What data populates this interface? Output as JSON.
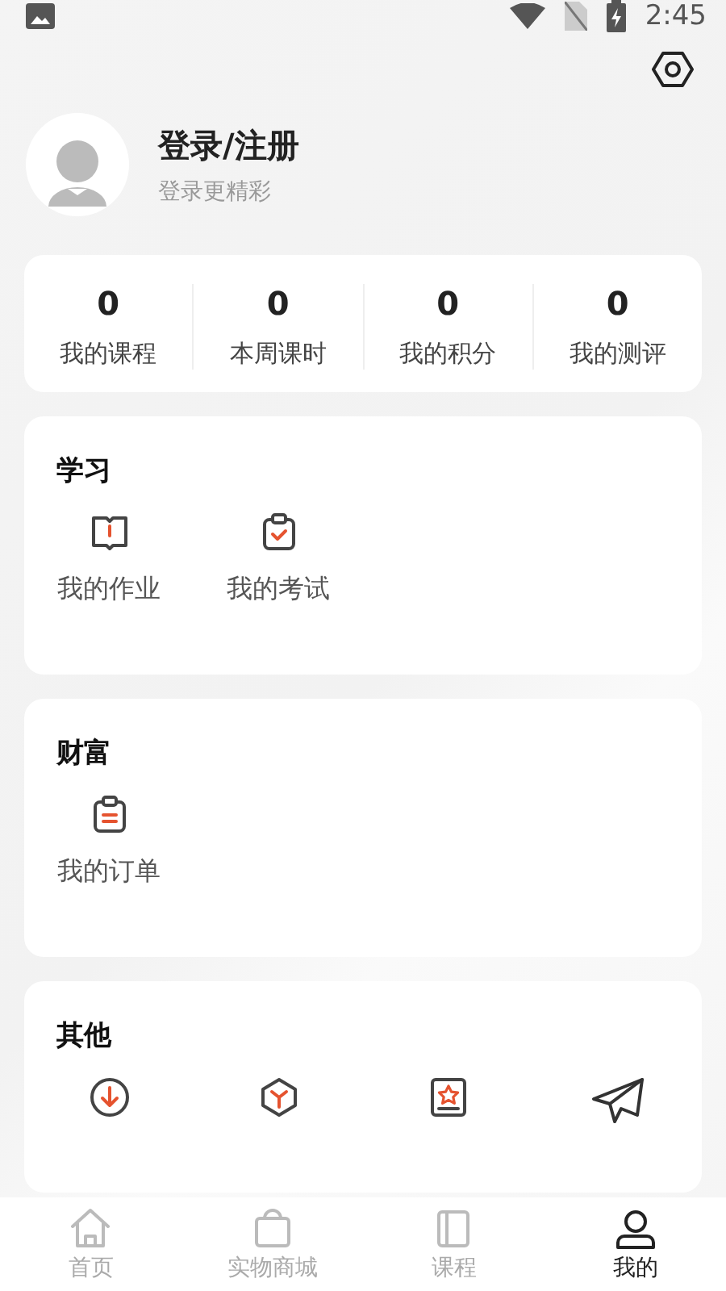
{
  "status_bar": {
    "time": "2:45"
  },
  "profile": {
    "title": "登录/注册",
    "subtitle": "登录更精彩"
  },
  "stats": [
    {
      "value": "0",
      "label": "我的课程"
    },
    {
      "value": "0",
      "label": "本周课时"
    },
    {
      "value": "0",
      "label": "我的积分"
    },
    {
      "value": "0",
      "label": "我的测评"
    }
  ],
  "sections": [
    {
      "title": "学习",
      "items": [
        {
          "kind": "book",
          "label": "我的作业"
        },
        {
          "kind": "exam",
          "label": "我的考试"
        }
      ]
    },
    {
      "title": "财富",
      "items": [
        {
          "kind": "order",
          "label": "我的订单"
        }
      ]
    },
    {
      "title": "其他",
      "items": [
        {
          "kind": "download"
        },
        {
          "kind": "hexagon"
        },
        {
          "kind": "star"
        },
        {
          "kind": "send"
        }
      ]
    }
  ],
  "bottom_nav": [
    {
      "kind": "home",
      "label": "首页",
      "selected": false
    },
    {
      "kind": "store",
      "label": "实物商城",
      "selected": false
    },
    {
      "kind": "course",
      "label": "课程",
      "selected": false
    },
    {
      "kind": "user",
      "label": "我的",
      "selected": true
    }
  ]
}
